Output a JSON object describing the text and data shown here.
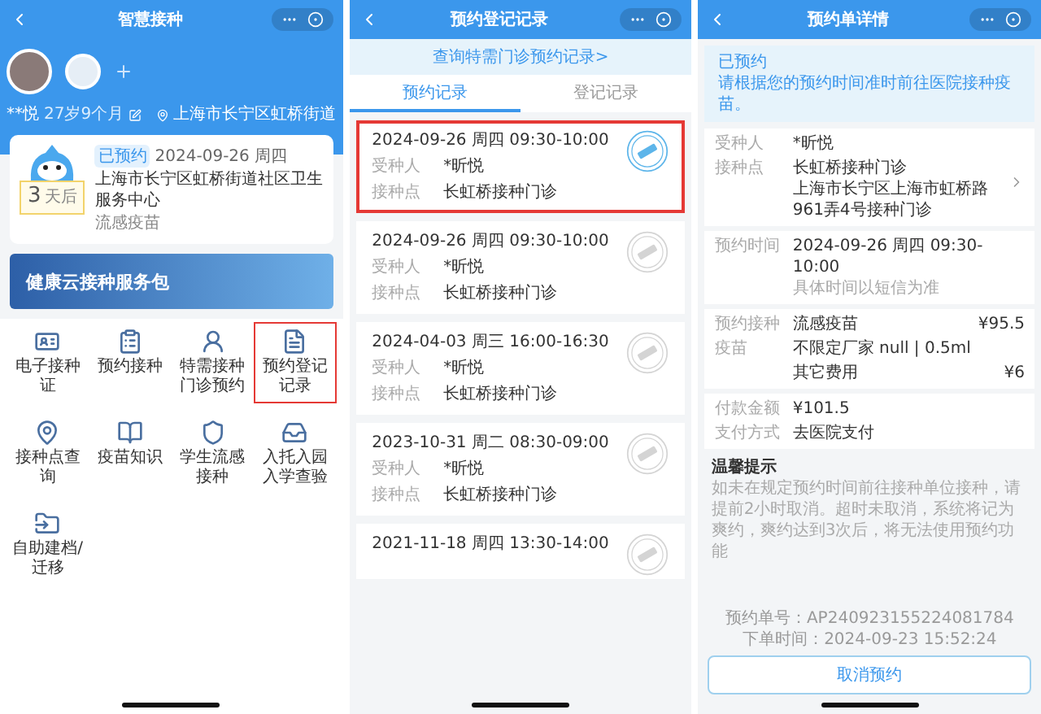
{
  "home": {
    "title": "智慧接种",
    "profile": {
      "name": "**悦",
      "age": "27岁9个月",
      "location": "上海市长宁区虹桥街道"
    },
    "card": {
      "count": "3",
      "count_unit": "天后",
      "tag": "已预约",
      "date": "2024-09-26 周四",
      "place": "上海市长宁区虹桥街道社区卫生服务中心",
      "vaccine": "流感疫苗"
    },
    "banner": "健康云接种服务包",
    "items": [
      {
        "label": "电子接种证",
        "highlighted": false
      },
      {
        "label": "预约接种",
        "highlighted": false
      },
      {
        "label": "特需接种门诊预约",
        "highlighted": false
      },
      {
        "label": "预约登记记录",
        "highlighted": true
      },
      {
        "label": "接种点查询",
        "highlighted": false
      },
      {
        "label": "疫苗知识",
        "highlighted": false
      },
      {
        "label": "学生流感接种",
        "highlighted": false
      },
      {
        "label": "入托入园入学查验",
        "highlighted": false
      },
      {
        "label": "自助建档/迁移",
        "highlighted": false
      }
    ]
  },
  "records": {
    "title": "预约登记记录",
    "link": "查询特需门诊预约记录>",
    "tabs": [
      {
        "label": "预约记录",
        "selected": true
      },
      {
        "label": "登记记录",
        "selected": false
      }
    ],
    "list": [
      {
        "time": "2024-09-26 周四 09:30-10:00",
        "active": true,
        "highlighted": true,
        "rows": [
          {
            "label": "受种人",
            "value": "*昕悦"
          },
          {
            "label": "接种点",
            "value": "长虹桥接种门诊"
          }
        ]
      },
      {
        "time": "2024-09-26 周四 09:30-10:00",
        "active": false,
        "highlighted": false,
        "rows": [
          {
            "label": "受种人",
            "value": "*昕悦"
          },
          {
            "label": "接种点",
            "value": "长虹桥接种门诊"
          }
        ]
      },
      {
        "time": "2024-04-03 周三 16:00-16:30",
        "active": false,
        "highlighted": false,
        "rows": [
          {
            "label": "受种人",
            "value": "*昕悦"
          },
          {
            "label": "接种点",
            "value": "长虹桥接种门诊"
          }
        ]
      },
      {
        "time": "2023-10-31 周二 08:30-09:00",
        "active": false,
        "highlighted": false,
        "rows": [
          {
            "label": "受种人",
            "value": "*昕悦"
          },
          {
            "label": "接种点",
            "value": "长虹桥接种门诊"
          }
        ]
      },
      {
        "time": "2021-11-18 周四 13:30-14:00",
        "active": false,
        "highlighted": false
      }
    ]
  },
  "detail": {
    "title": "预约单详情",
    "status": "已预约",
    "message": "请根据您的预约时间准时前往医院接种疫苗。",
    "sections": [
      [
        {
          "label": "受种人",
          "lines": [
            "*昕悦"
          ]
        },
        {
          "label": "接种点",
          "lines": [
            "长虹桥接种门诊",
            "上海市长宁区上海市虹桥路961弄4号接种门诊"
          ],
          "link": true
        }
      ],
      [
        {
          "label": "预约时间",
          "lines": [
            "2024-09-26 周四 09:30-10:00",
            "具体时间以短信为准"
          ]
        }
      ],
      [
        {
          "label": "预约接种",
          "lines": [
            "流感疫苗"
          ],
          "price": "¥95.5"
        },
        {
          "label": "疫苗",
          "lines": [
            "不限定厂家 null | 0.5ml"
          ]
        },
        {
          "lines": [
            "其它费用"
          ],
          "price": "¥6"
        }
      ],
      [
        {
          "label": "付款金额",
          "lines": [
            "¥101.5"
          ]
        },
        {
          "label": "支付方式",
          "lines": [
            "去医院支付"
          ]
        }
      ]
    ],
    "tip_title": "温馨提示",
    "tip": "如未在规定预约时间前往接种单位接种，请提前2小时取消。超时未取消，系统将记为爽约，爽约达到3次后，将无法使用预约功能",
    "order_no": "预约单号：AP240923155224081784",
    "order_time": "下单时间：2024-09-23 15:52:24",
    "button": "取消预约"
  }
}
